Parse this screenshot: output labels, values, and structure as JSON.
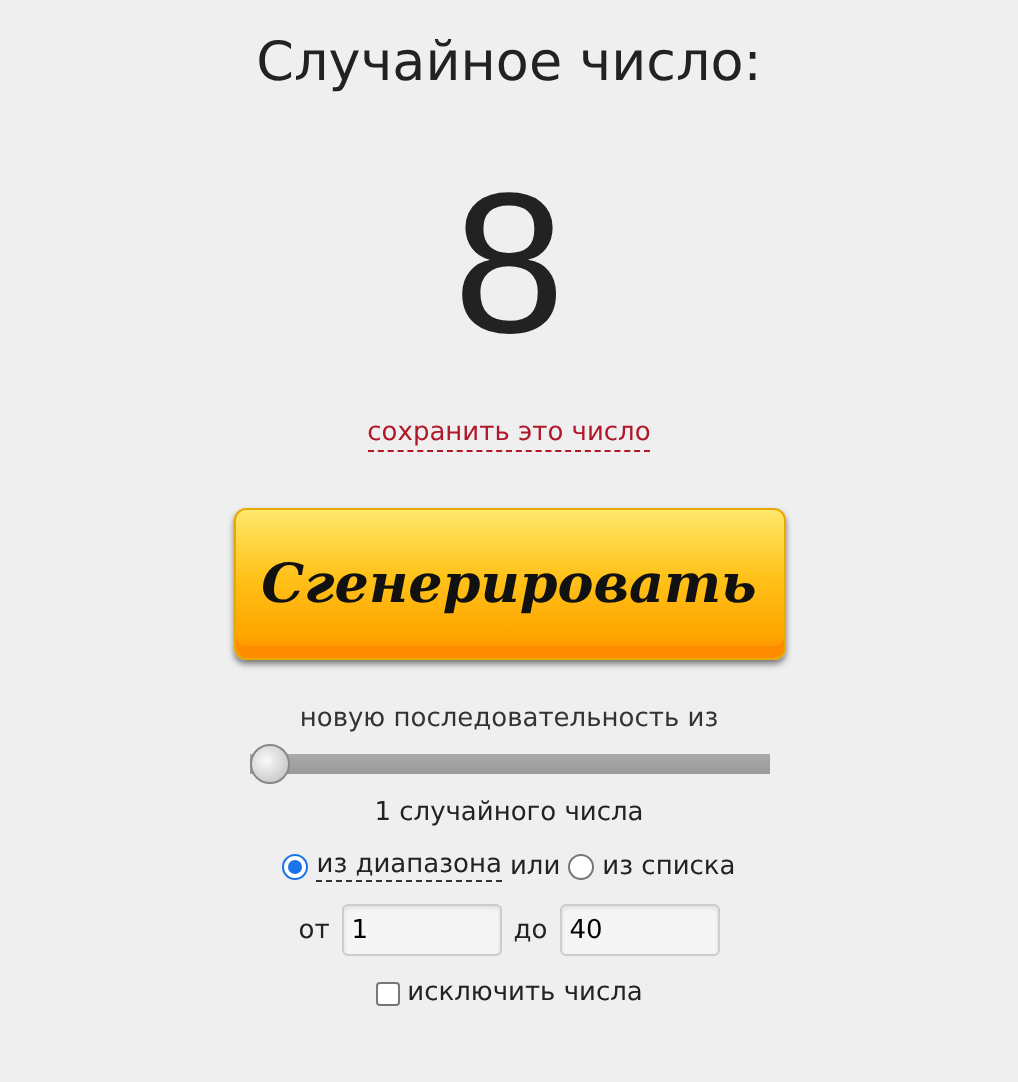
{
  "title": "Случайное число:",
  "result": "8",
  "save_link": "сохранить это число",
  "generate_button": "Сгенерировать",
  "sequence_label": "новую последовательность из",
  "count_slider": {
    "level": 0.0
  },
  "count_text": "1 случайного числа",
  "source_options": [
    {
      "label": "из диапазона",
      "selected": true
    },
    {
      "label": "из списка",
      "selected": false
    }
  ],
  "options_joiner": "или",
  "range": {
    "from_label": "от",
    "from_value": "1",
    "to_label": "до",
    "to_value": "40"
  },
  "exclude": {
    "label": "исключить числа",
    "checked": false
  }
}
